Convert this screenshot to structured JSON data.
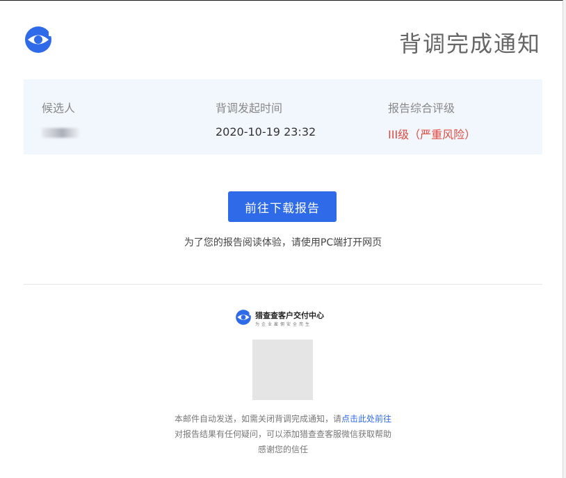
{
  "header": {
    "title": "背调完成通知",
    "logo_icon": "eye-logo-icon",
    "brand_color": "#2f6be8"
  },
  "info": {
    "candidate_label": "候选人",
    "start_time_label": "背调发起时间",
    "start_time_value": "2020-10-19 23:32",
    "rating_label": "报告综合评级",
    "rating_value": "III级（严重风险）",
    "rating_color": "#e04a3f"
  },
  "action": {
    "download_label": "前往下载报告",
    "hint": "为了您的报告阅读体验，请使用PC端打开网页"
  },
  "footer": {
    "brand": "猎查查客户交付中心",
    "slogan": "为企业雇佣安全而生",
    "notice_prefix": "本邮件自动发送，如需关闭背调完成通知，请",
    "notice_link": "点击此处前往",
    "help_text": "对报告结果有任何疑问，可以添加猎查查客服微信获取帮助",
    "thanks": "感谢您的信任"
  }
}
